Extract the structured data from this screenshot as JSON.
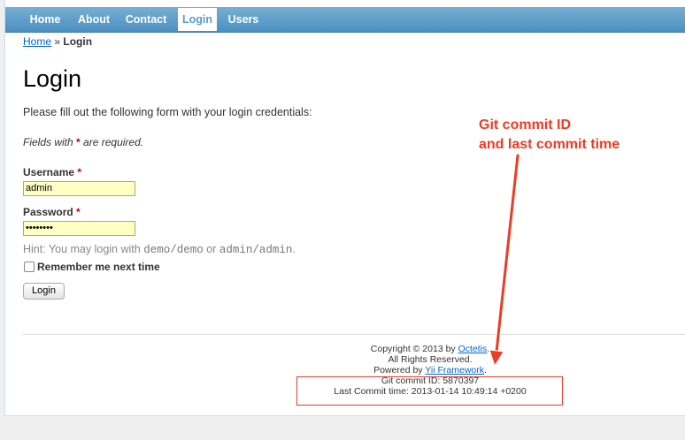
{
  "nav": {
    "items": [
      {
        "label": "Home"
      },
      {
        "label": "About"
      },
      {
        "label": "Contact"
      },
      {
        "label": "Login",
        "active": true
      },
      {
        "label": "Users"
      }
    ]
  },
  "breadcrumb": {
    "home": "Home",
    "separator": "»",
    "current": "Login"
  },
  "page": {
    "title": "Login",
    "intro": "Please fill out the following form with your login credentials:",
    "required_note_prefix": "Fields with",
    "required_marker": "*",
    "required_note_suffix": "are required."
  },
  "form": {
    "username_label": "Username",
    "username_value": "admin",
    "password_label": "Password",
    "password_value": "••••••••",
    "hint_prefix": "Hint: You may login with",
    "hint_demo": "demo/demo",
    "hint_or": "or",
    "hint_admin": "admin/admin",
    "hint_suffix": ".",
    "remember_label": "Remember me next time",
    "remember_checked": false,
    "submit_label": "Login"
  },
  "footer": {
    "copyright_prefix": "Copyright © 2013 by",
    "company": "Octetis",
    "copyright_suffix": ".",
    "rights": "All Rights Reserved.",
    "powered_prefix": "Powered by",
    "framework": "Yii Framework",
    "powered_suffix": ".",
    "commit_id": "Git commit ID: 5870397",
    "commit_time": "Last Commit time: 2013-01-14 10:49:14 +0200"
  },
  "annotation": {
    "line1": "Git commit ID",
    "line2": "and last commit time",
    "color": "#ee3b24"
  },
  "colors": {
    "nav_top": "#77afd3",
    "nav_bottom": "#4a8fc1",
    "input_bg": "#ffffc4",
    "link": "#0066cc",
    "required": "#cc0000"
  }
}
